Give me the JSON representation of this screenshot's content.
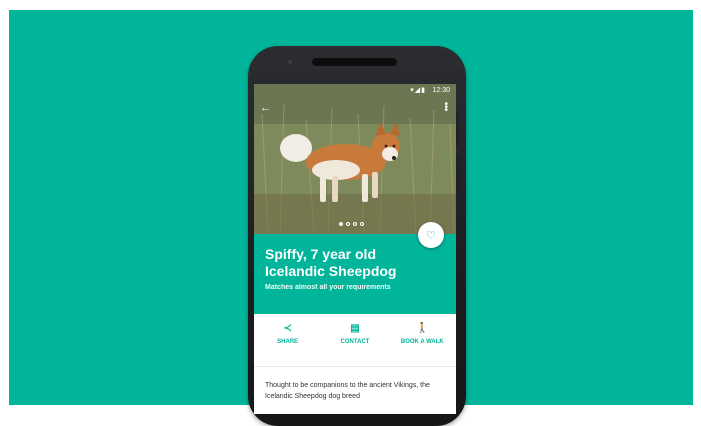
{
  "status_bar": {
    "time": "12:30"
  },
  "listing": {
    "title": "Spiffy, 7 year old Icelandic Sheepdog",
    "subtitle": "Matches almost all your requirements"
  },
  "carousel": {
    "total": 4,
    "active": 0
  },
  "actions": [
    {
      "label": "SHARE",
      "icon": "share-icon"
    },
    {
      "label": "CONTACT",
      "icon": "message-icon"
    },
    {
      "label": "BOOK A WALK",
      "icon": "walk-icon"
    }
  ],
  "description": "Thought to be companions to the ancient Vikings, the Icelandic Sheepdog dog breed",
  "colors": {
    "accent": "#00b59a",
    "background": "#00b59a"
  }
}
